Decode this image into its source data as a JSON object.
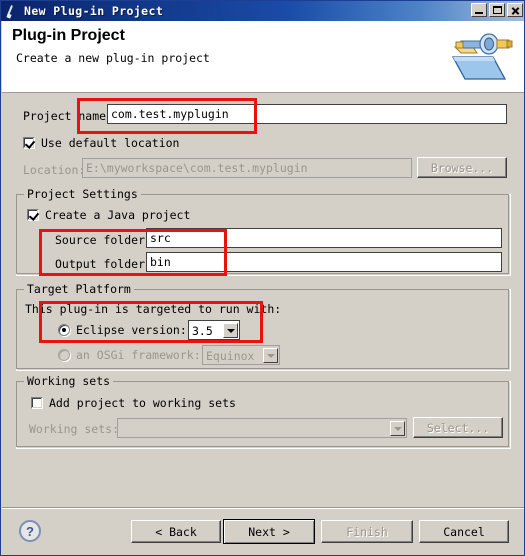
{
  "window": {
    "title": "New Plug-in Project",
    "icon": "plugin-pen-icon",
    "controls": {
      "minimize": "Minimize",
      "maximize": "Maximize",
      "close": "Close"
    }
  },
  "header": {
    "title": "Plug-in Project",
    "description": "Create a new plug-in project",
    "banner_icon": "plugin-connector-folder-icon"
  },
  "form": {
    "project_name_label": "Project name:",
    "project_name_value": "com.test.myplugin",
    "use_default_location_label": "Use default location",
    "use_default_location_checked": true,
    "location_label": "Location:",
    "location_value": "E:\\myworkspace\\com.test.myplugin",
    "browse_label": "Browse..."
  },
  "project_settings": {
    "group_label": "Project Settings",
    "create_java_project_label": "Create a Java project",
    "create_java_project_checked": true,
    "source_folder_label": "Source folder:",
    "source_folder_value": "src",
    "output_folder_label": "Output folder:",
    "output_folder_value": "bin"
  },
  "target_platform": {
    "group_label": "Target Platform",
    "intro_label": "This plug-in is targeted to run with:",
    "eclipse_version_label": "Eclipse version:",
    "eclipse_version_selected": true,
    "eclipse_version_value": "3.5",
    "osgi_framework_label": "an OSGi framework:",
    "osgi_framework_selected": false,
    "osgi_framework_value": "Equinox"
  },
  "working_sets": {
    "group_label": "Working sets",
    "add_project_label": "Add project to working sets",
    "add_project_checked": false,
    "working_sets_label": "Working sets:",
    "working_sets_value": "",
    "select_label": "Select..."
  },
  "footer": {
    "help_glyph": "?",
    "back_label": "< Back",
    "next_label": "Next >",
    "finish_label": "Finish",
    "cancel_label": "Cancel"
  },
  "colors": {
    "annotation": "#e8120f",
    "window_background": "#d4d0c8",
    "titlebar_start": "#0a246a",
    "titlebar_end": "#a6bede",
    "header_background": "#ffffff",
    "disabled_text": "#9a968e"
  }
}
